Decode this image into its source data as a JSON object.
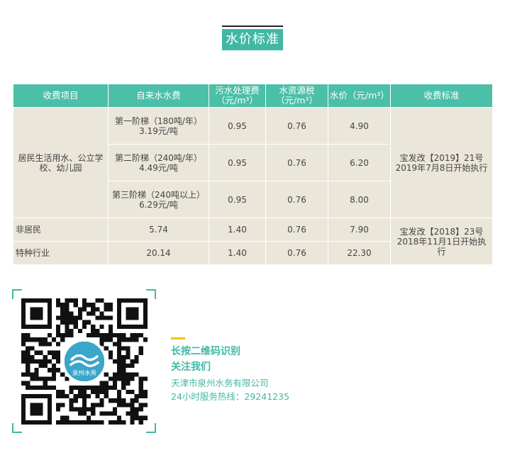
{
  "title": "水价标准",
  "table": {
    "headers": [
      "收费项目",
      "自来水水费",
      "污水处理费（元/m³）",
      "水资源税（元/m³）",
      "水价（元/m³）",
      "收费标准"
    ],
    "resident_category": "居民生活用水、公立学校、幼儿园",
    "tier_rows": [
      {
        "tap": "第一阶梯（180吨/年）3.19元/吨",
        "sewage": "0.95",
        "resource": "0.76",
        "price": "4.90"
      },
      {
        "tap": "第二阶梯（240吨/年）4.49元/吨",
        "sewage": "0.95",
        "resource": "0.76",
        "price": "6.20"
      },
      {
        "tap": "第三阶梯（240吨以上）6.29元/吨",
        "sewage": "0.95",
        "resource": "0.76",
        "price": "8.00"
      }
    ],
    "resident_standard": "宝发改【2019】21号2019年7月8日开始执行",
    "other_rows": [
      {
        "category": "非居民",
        "tap": "5.74",
        "sewage": "1.40",
        "resource": "0.76",
        "price": "7.90"
      },
      {
        "category": "特种行业",
        "tap": "20.14",
        "sewage": "1.40",
        "resource": "0.76",
        "price": "22.30"
      }
    ],
    "other_standard": "宝发改【2018】23号2018年11月1日开始执行"
  },
  "qr": {
    "logo_text": "泉州水务",
    "icon": "qr-code-icon"
  },
  "contact": {
    "cta_line1": "长按二维码识别",
    "cta_line2": "关注我们",
    "company": "天津市泉州水务有限公司",
    "hotline": "24小时服务热线：29241235"
  },
  "colors": {
    "accent": "#42b8a4",
    "header_bg": "#4cbfa8",
    "cell_bg": "#ebe6da",
    "highlight": "#f0c40f"
  }
}
